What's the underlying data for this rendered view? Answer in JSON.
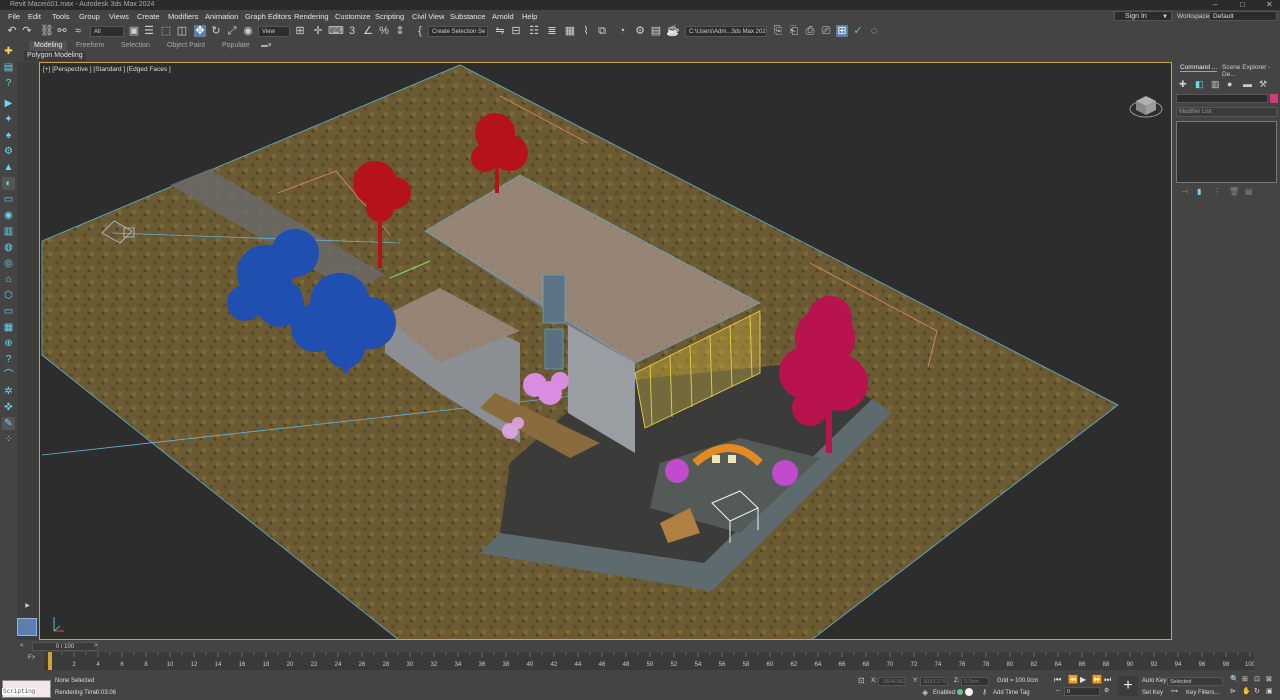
{
  "window": {
    "title": "Revit Maceió01.max - Autodesk 3ds Max 2024",
    "controls": [
      "–",
      "□",
      "✕"
    ]
  },
  "menu": [
    "File",
    "Edit",
    "Tools",
    "Group",
    "Views",
    "Create",
    "Modifiers",
    "Animation",
    "Graph Editors",
    "Rendering",
    "Customize",
    "Scripting",
    "Civil View",
    "Substance",
    "Arnold",
    "Help"
  ],
  "account": {
    "sign_in": "Sign In",
    "workspaces_label": "Workspaces:",
    "workspace": "Default"
  },
  "toolbar": {
    "selection_filter": "All",
    "reference_coord": "View",
    "named_selection": "Create Selection Se",
    "project_path": "C:\\Users\\Adm...3ds Max 2024"
  },
  "ribbon": {
    "tabs": [
      "Modeling",
      "Freeform",
      "Selection",
      "Object Paint",
      "Populate"
    ],
    "active_tab": "Modeling",
    "sub_panel": "Polygon Modeling"
  },
  "viewport": {
    "label": "[+] [Perspective ] [Standard ] [Edged Faces ]"
  },
  "command_panel": {
    "tabs": [
      "Command ...",
      "Scene Explorer - De..."
    ],
    "modifier_list": "Modifier List"
  },
  "timeline": {
    "frame_slider": "0 / 100",
    "ticks": [
      "0",
      "2",
      "4",
      "6",
      "8",
      "10",
      "12",
      "14",
      "16",
      "18",
      "20",
      "22",
      "24",
      "26",
      "28",
      "30",
      "32",
      "34",
      "36",
      "38",
      "40",
      "42",
      "44",
      "46",
      "48",
      "50",
      "52",
      "54",
      "56",
      "58",
      "60",
      "62",
      "64",
      "66",
      "68",
      "70",
      "72",
      "74",
      "76",
      "78",
      "80",
      "82",
      "84",
      "86",
      "88",
      "90",
      "92",
      "94",
      "96",
      "98",
      "100"
    ]
  },
  "status": {
    "maxscript": "Scripting",
    "selection": "None Selected",
    "render_time_label": "Rendering Time",
    "render_time": "0:03:06",
    "x_label": "X:",
    "x_value": "-3604.962",
    "y_label": "Y:",
    "y_value": "3033.279",
    "z_label": "Z:",
    "z_value": "0.0cm",
    "grid": "Grid = 100.0cm",
    "enabled_label": "Enabled:",
    "add_time_tag": "Add Time Tag",
    "frame_value": "0",
    "auto_key": "Auto Key",
    "set_key": "Set Key",
    "key_mode": "Selected",
    "key_filters": "Key Filters..."
  },
  "colors": {
    "accent": "#6cb0e4",
    "viewport_border": "#d0a72c",
    "tree_blue": "#1f4fb0",
    "tree_red": "#b5121b",
    "tree_magenta": "#b8124f",
    "foliage_pink": "#d47fe0",
    "ground": "#6b5a32"
  }
}
